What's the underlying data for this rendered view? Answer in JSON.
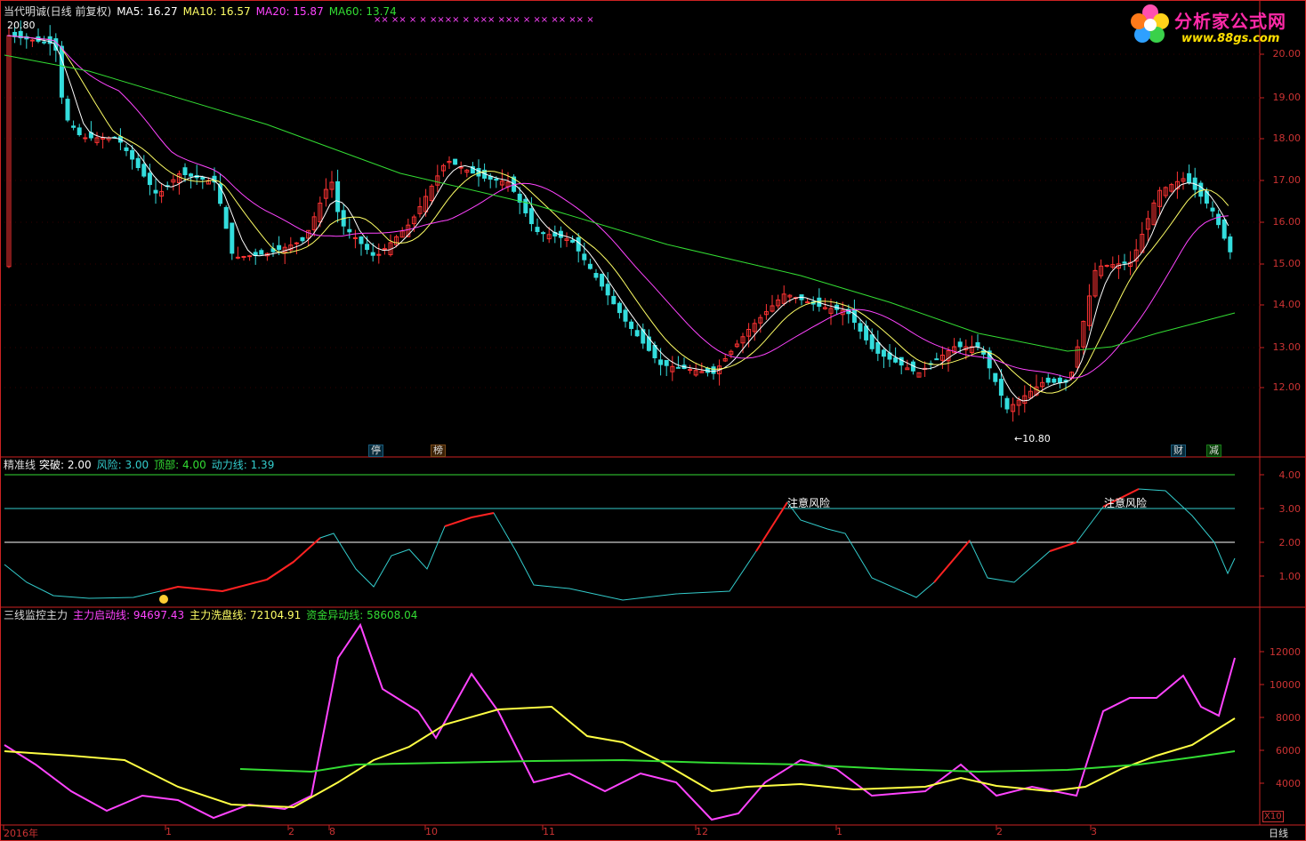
{
  "panel1": {
    "title": "当代明诚(日线 前复权)",
    "indicators": [
      {
        "label": "MA5: 16.27",
        "color": "#ffffff"
      },
      {
        "label": "MA10: 16.57",
        "color": "#ffff66"
      },
      {
        "label": "MA20: 15.87",
        "color": "#ff44ff"
      },
      {
        "label": "MA60: 13.74",
        "color": "#33dd33"
      }
    ],
    "y_ticks": [
      "20.00",
      "19.00",
      "18.00",
      "17.00",
      "16.00",
      "15.00",
      "14.00",
      "13.00",
      "12.00"
    ],
    "high_marker": "20.80",
    "low_marker": "←10.80",
    "cross_marks": "×× ××   ×   ×  ××××    ×         ×××   ×××      ×        ××        ××   ×× ×",
    "badges": [
      {
        "text": "停",
        "color": "#33ccff"
      },
      {
        "text": "榜",
        "color": "#ff9933"
      },
      {
        "text": "财",
        "color": "#33ccff"
      },
      {
        "text": "减",
        "color": "#33ff33"
      }
    ]
  },
  "panel2": {
    "title": "精准线",
    "indicators": [
      {
        "label": "突破: 2.00",
        "color": "#ffffff"
      },
      {
        "label": "风险: 3.00",
        "color": "#33cccc"
      },
      {
        "label": "顶部: 4.00",
        "color": "#33dd33"
      },
      {
        "label": "动力线: 1.39",
        "color": "#33cccc"
      }
    ],
    "y_ticks": [
      "4.00",
      "3.00",
      "2.00",
      "1.00"
    ],
    "annotations": [
      "注意风险",
      "注意风险"
    ]
  },
  "panel3": {
    "title": "三线监控主力",
    "indicators": [
      {
        "label": "主力启动线: 94697.43",
        "color": "#ff44ff"
      },
      {
        "label": "主力洗盘线: 72104.91",
        "color": "#ffff66"
      },
      {
        "label": "资金异动线: 58608.04",
        "color": "#33dd33"
      }
    ],
    "y_ticks": [
      "12000",
      "10000",
      "8000",
      "6000",
      "4000"
    ],
    "unit": "X10"
  },
  "x_axis": {
    "labels": [
      "2016年",
      "1",
      "2",
      "8",
      "10",
      "11",
      "12",
      "1",
      "2",
      "3"
    ],
    "period": "日线"
  },
  "logo": {
    "title": "分析家公式网",
    "url": "www.88gs.com"
  },
  "colors": {
    "up": "#ff3333",
    "down": "#33dddd",
    "ma5": "#ffffff",
    "ma10": "#ffff66",
    "ma20": "#ff44ff",
    "ma60": "#33dd33",
    "axis": "#cc2222"
  }
}
